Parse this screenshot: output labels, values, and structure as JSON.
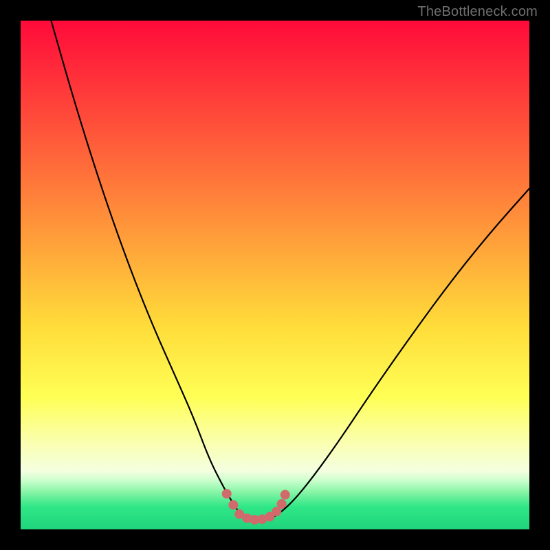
{
  "watermark": "TheBottleneck.com",
  "colors": {
    "frame": "#000000",
    "curve_stroke": "#000000",
    "marker_fill": "#d16a6a",
    "marker_stroke": "#c05050",
    "gradient_stops": [
      {
        "offset": 0.0,
        "color": "#ff0a3a"
      },
      {
        "offset": 0.2,
        "color": "#ff4e3a"
      },
      {
        "offset": 0.4,
        "color": "#ff943a"
      },
      {
        "offset": 0.6,
        "color": "#ffdc3a"
      },
      {
        "offset": 0.74,
        "color": "#ffff55"
      },
      {
        "offset": 0.83,
        "color": "#faffb0"
      },
      {
        "offset": 0.885,
        "color": "#f4ffe0"
      },
      {
        "offset": 0.905,
        "color": "#c8ffcc"
      },
      {
        "offset": 0.925,
        "color": "#8cf5a8"
      },
      {
        "offset": 0.955,
        "color": "#30e787"
      },
      {
        "offset": 1.0,
        "color": "#1fd47c"
      }
    ]
  },
  "chart_data": {
    "type": "line",
    "title": "",
    "xlabel": "",
    "ylabel": "",
    "xlim": [
      0,
      100
    ],
    "ylim": [
      0,
      100
    ],
    "grid": false,
    "series": [
      {
        "name": "bottleneck-curve",
        "x": [
          6,
          10,
          14,
          18,
          22,
          26,
          30,
          34,
          37,
          39.5,
          41.5,
          43,
          45,
          47,
          49,
          51,
          54,
          58,
          63,
          69,
          76,
          84,
          92,
          100
        ],
        "y": [
          100,
          86,
          73,
          61,
          50,
          40,
          31,
          22,
          14,
          9,
          5.5,
          3.2,
          2.0,
          1.8,
          2.0,
          3.2,
          6.0,
          11,
          18,
          27,
          37,
          48,
          58,
          67
        ]
      }
    ],
    "markers": {
      "name": "highlight-region",
      "x": [
        40.5,
        41.8,
        43.0,
        44.5,
        46.0,
        47.5,
        49.0,
        50.3,
        51.3,
        52.0
      ],
      "y": [
        7.0,
        4.8,
        3.0,
        2.2,
        1.9,
        2.0,
        2.5,
        3.5,
        5.0,
        6.8
      ]
    },
    "annotations": []
  }
}
